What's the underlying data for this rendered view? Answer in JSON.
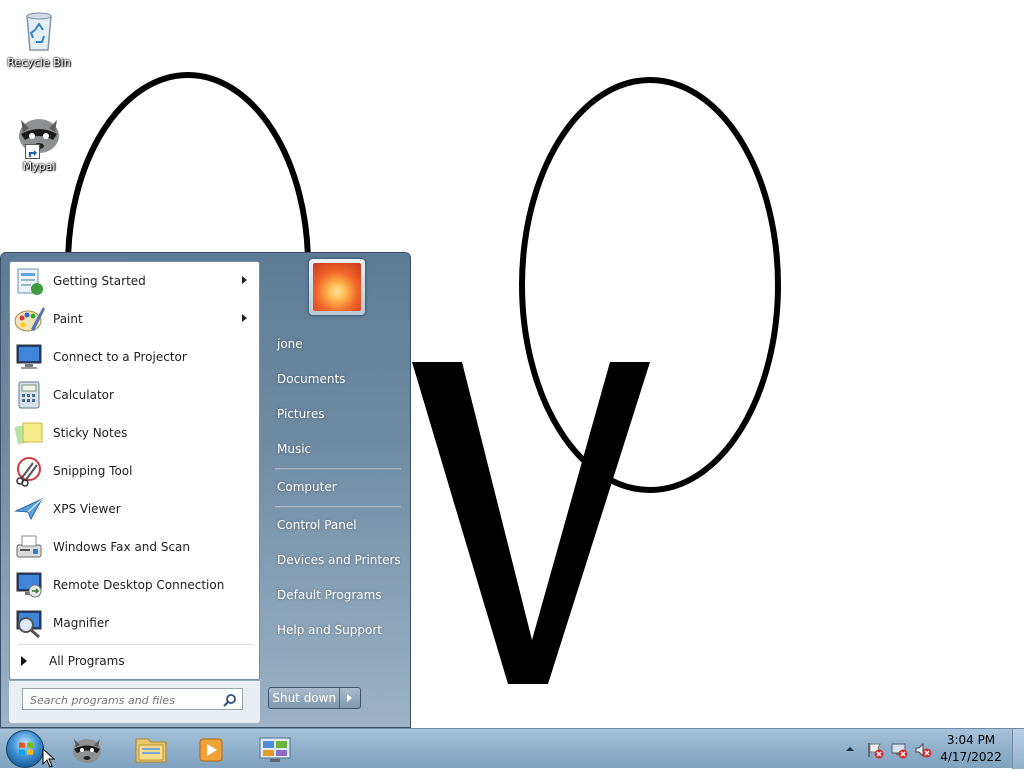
{
  "desktop": {
    "icons": [
      {
        "label": "Recycle Bin",
        "icon": "recycle-bin-icon"
      },
      {
        "label": "Mypal",
        "icon": "mypal-icon"
      }
    ]
  },
  "start_menu": {
    "programs": [
      {
        "label": "Getting Started",
        "icon": "getting-started-icon",
        "submenu": true
      },
      {
        "label": "Paint",
        "icon": "paint-icon",
        "submenu": true
      },
      {
        "label": "Connect to a Projector",
        "icon": "projector-icon",
        "submenu": false
      },
      {
        "label": "Calculator",
        "icon": "calculator-icon",
        "submenu": false
      },
      {
        "label": "Sticky Notes",
        "icon": "sticky-notes-icon",
        "submenu": false
      },
      {
        "label": "Snipping Tool",
        "icon": "snipping-tool-icon",
        "submenu": false
      },
      {
        "label": "XPS Viewer",
        "icon": "xps-viewer-icon",
        "submenu": false
      },
      {
        "label": "Windows Fax and Scan",
        "icon": "fax-scan-icon",
        "submenu": false
      },
      {
        "label": "Remote Desktop Connection",
        "icon": "remote-desktop-icon",
        "submenu": false
      },
      {
        "label": "Magnifier",
        "icon": "magnifier-icon",
        "submenu": false
      }
    ],
    "all_programs": "All Programs",
    "search_placeholder": "Search programs and files",
    "right_links": {
      "user": "jone",
      "documents": "Documents",
      "pictures": "Pictures",
      "music": "Music",
      "computer": "Computer",
      "control_panel": "Control Panel",
      "devices_printers": "Devices and Printers",
      "default_programs": "Default Programs",
      "help_support": "Help and Support"
    },
    "shutdown_label": "Shut down"
  },
  "taskbar": {
    "pinned": [
      {
        "name": "mypal-taskbar-button",
        "icon": "mypal-icon"
      },
      {
        "name": "explorer-taskbar-button",
        "icon": "folder-icon"
      },
      {
        "name": "media-player-taskbar-button",
        "icon": "media-player-icon"
      },
      {
        "name": "control-panel-taskbar-button",
        "icon": "control-panel-icon"
      }
    ],
    "clock_time": "3:04 PM",
    "clock_date": "4/17/2022"
  },
  "colors": {
    "start_menu_bg": "#6f8ba2",
    "taskbar_bg": "#8fb0cb",
    "desktop_bg": "#ffffff"
  }
}
